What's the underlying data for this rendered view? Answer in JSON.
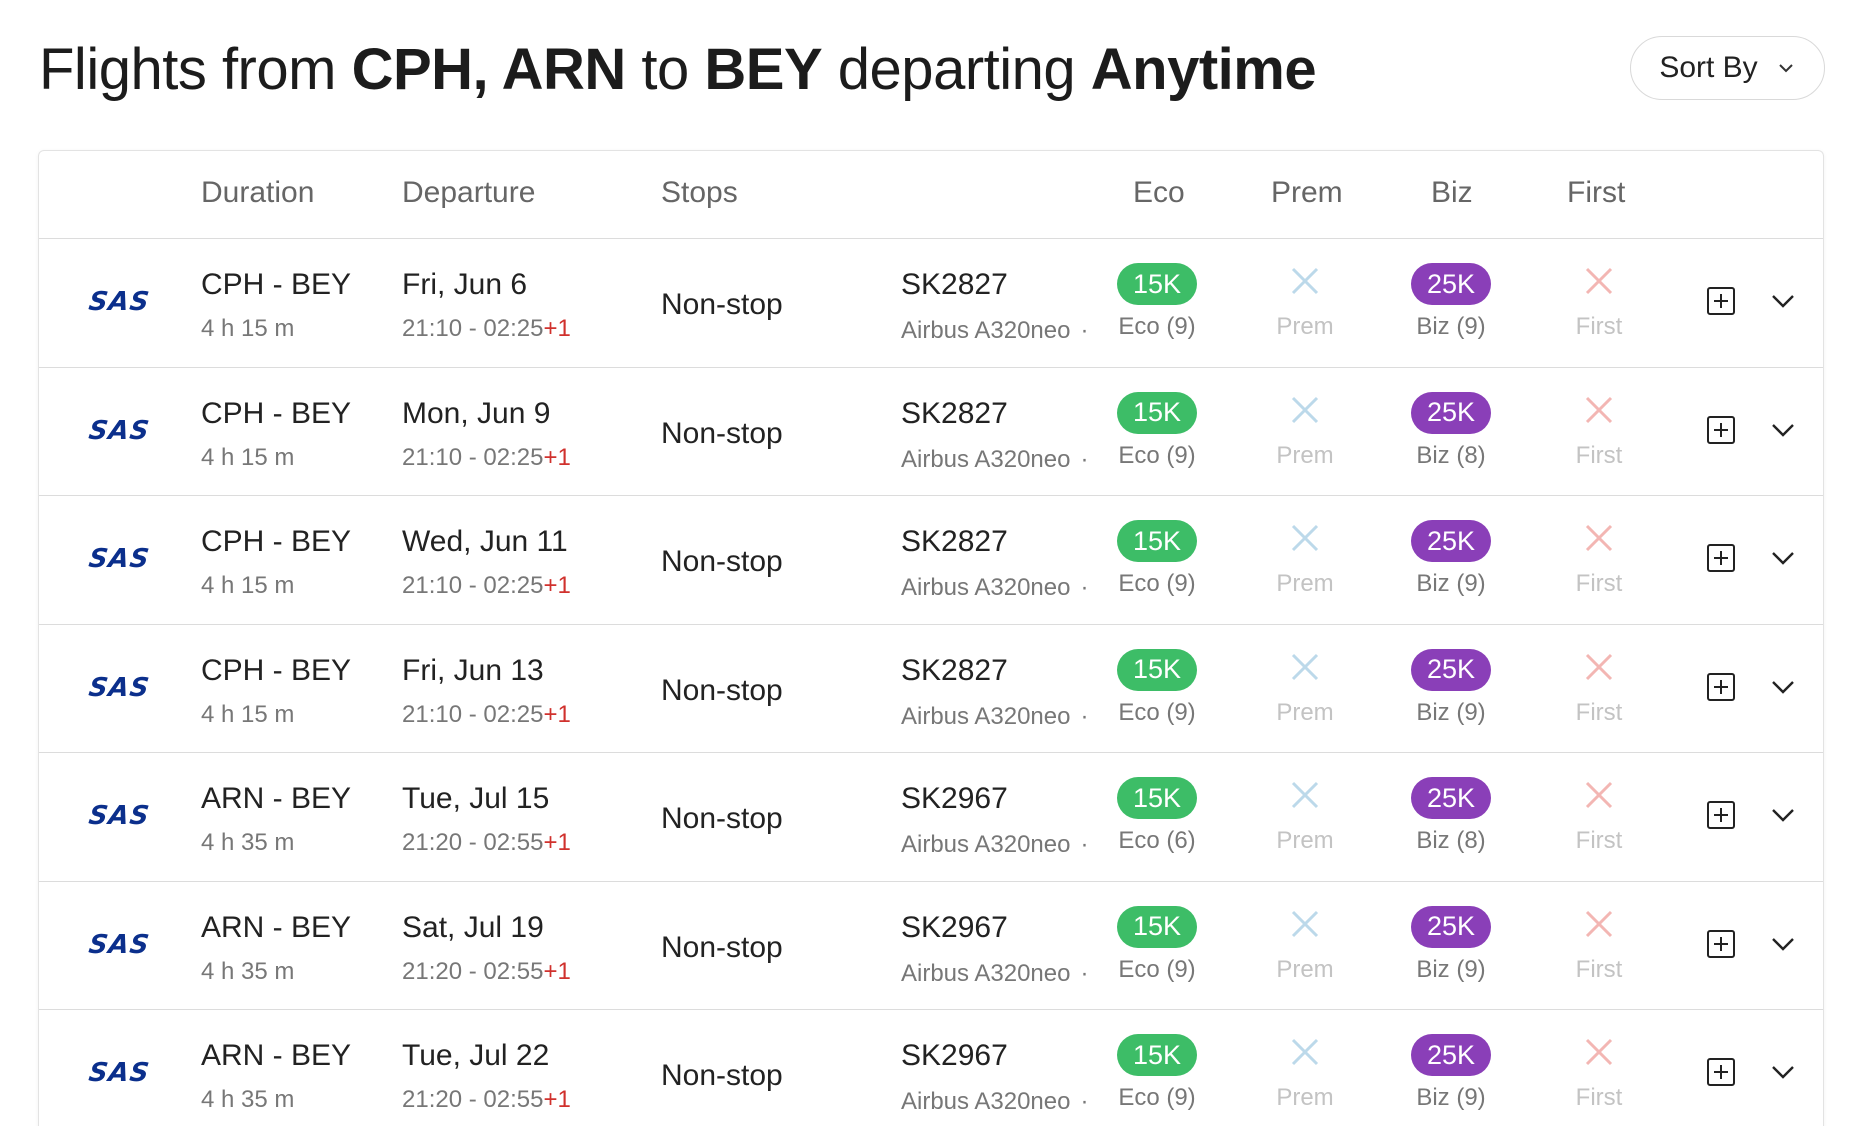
{
  "title": {
    "prefix": "Flights from",
    "origins": "CPH, ARN",
    "to": "to",
    "destination": "BEY",
    "departing": "departing",
    "when": "Anytime"
  },
  "sort": {
    "label": "Sort By"
  },
  "headers": {
    "duration": "Duration",
    "departure": "Departure",
    "stops": "Stops",
    "eco": "Eco",
    "prem": "Prem",
    "biz": "Biz",
    "first": "First"
  },
  "colors": {
    "eco": "#3dbd67",
    "biz": "#8a3fb8",
    "unavailable": "#f3b6b3",
    "prem_unavailable": "#bcd9ea",
    "next_day": "#d0312d"
  },
  "rows": [
    {
      "airline": "SAS",
      "route": "CPH - BEY",
      "duration": "4 h 15 m",
      "date": "Fri, Jun 6",
      "times": "21:10 - 02:25",
      "next_day": "+1",
      "stops": "Non-stop",
      "flight": "SK2827",
      "aircraft": "Airbus A320neo",
      "sep": "·",
      "eco_price": "15K",
      "eco_seats": "Eco (9)",
      "prem_label": "Prem",
      "biz_price": "25K",
      "biz_seats": "Biz (9)",
      "first_label": "First"
    },
    {
      "airline": "SAS",
      "route": "CPH - BEY",
      "duration": "4 h 15 m",
      "date": "Mon, Jun 9",
      "times": "21:10 - 02:25",
      "next_day": "+1",
      "stops": "Non-stop",
      "flight": "SK2827",
      "aircraft": "Airbus A320neo",
      "sep": "·",
      "eco_price": "15K",
      "eco_seats": "Eco (9)",
      "prem_label": "Prem",
      "biz_price": "25K",
      "biz_seats": "Biz (8)",
      "first_label": "First"
    },
    {
      "airline": "SAS",
      "route": "CPH - BEY",
      "duration": "4 h 15 m",
      "date": "Wed, Jun 11",
      "times": "21:10 - 02:25",
      "next_day": "+1",
      "stops": "Non-stop",
      "flight": "SK2827",
      "aircraft": "Airbus A320neo",
      "sep": "·",
      "eco_price": "15K",
      "eco_seats": "Eco (9)",
      "prem_label": "Prem",
      "biz_price": "25K",
      "biz_seats": "Biz (9)",
      "first_label": "First"
    },
    {
      "airline": "SAS",
      "route": "CPH - BEY",
      "duration": "4 h 15 m",
      "date": "Fri, Jun 13",
      "times": "21:10 - 02:25",
      "next_day": "+1",
      "stops": "Non-stop",
      "flight": "SK2827",
      "aircraft": "Airbus A320neo",
      "sep": "·",
      "eco_price": "15K",
      "eco_seats": "Eco (9)",
      "prem_label": "Prem",
      "biz_price": "25K",
      "biz_seats": "Biz (9)",
      "first_label": "First"
    },
    {
      "airline": "SAS",
      "route": "ARN - BEY",
      "duration": "4 h 35 m",
      "date": "Tue, Jul 15",
      "times": "21:20 - 02:55",
      "next_day": "+1",
      "stops": "Non-stop",
      "flight": "SK2967",
      "aircraft": "Airbus A320neo",
      "sep": "·",
      "eco_price": "15K",
      "eco_seats": "Eco (6)",
      "prem_label": "Prem",
      "biz_price": "25K",
      "biz_seats": "Biz (8)",
      "first_label": "First"
    },
    {
      "airline": "SAS",
      "route": "ARN - BEY",
      "duration": "4 h 35 m",
      "date": "Sat, Jul 19",
      "times": "21:20 - 02:55",
      "next_day": "+1",
      "stops": "Non-stop",
      "flight": "SK2967",
      "aircraft": "Airbus A320neo",
      "sep": "·",
      "eco_price": "15K",
      "eco_seats": "Eco (9)",
      "prem_label": "Prem",
      "biz_price": "25K",
      "biz_seats": "Biz (9)",
      "first_label": "First"
    },
    {
      "airline": "SAS",
      "route": "ARN - BEY",
      "duration": "4 h 35 m",
      "date": "Tue, Jul 22",
      "times": "21:20 - 02:55",
      "next_day": "+1",
      "stops": "Non-stop",
      "flight": "SK2967",
      "aircraft": "Airbus A320neo",
      "sep": "·",
      "eco_price": "15K",
      "eco_seats": "Eco (9)",
      "prem_label": "Prem",
      "biz_price": "25K",
      "biz_seats": "Biz (9)",
      "first_label": "First"
    }
  ]
}
